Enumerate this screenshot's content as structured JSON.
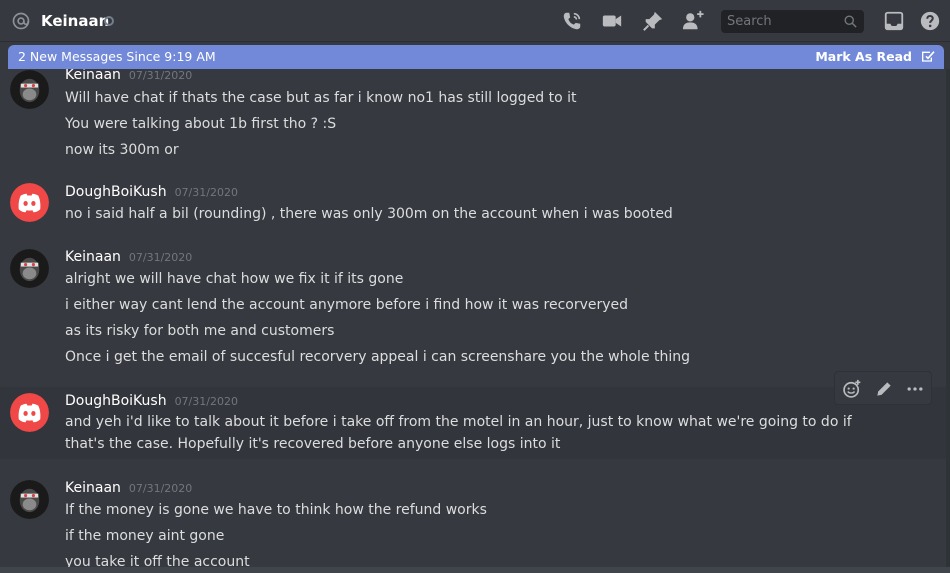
{
  "header": {
    "channel_name": "Keinaan",
    "search_placeholder": "Search"
  },
  "new_messages_bar": {
    "text": "2 New Messages Since 9:19 AM",
    "mark_label": "Mark As Read"
  },
  "messages": [
    {
      "author": "Keinaan",
      "timestamp": "07/31/2020",
      "lines": [
        "Will have chat if thats the case but as far i know no1 has still logged to it",
        "You were talking about 1b first tho ? :S",
        "now its 300m or"
      ]
    },
    {
      "author": "DoughBoiKush",
      "timestamp": "07/31/2020",
      "lines": [
        "no i said half a bil (rounding) , there was only 300m on the account when i was booted"
      ]
    },
    {
      "author": "Keinaan",
      "timestamp": "07/31/2020",
      "lines": [
        "alright we will have chat how we fix it if its gone",
        "i either way cant lend the account anymore before i find how it was recorveryed",
        "as its risky for both me and customers",
        "Once i get the email of succesful recorvery appeal i can screenshare you the whole thing"
      ]
    },
    {
      "author": "DoughBoiKush",
      "timestamp": "07/31/2020",
      "lines": [
        "and yeh i'd like to talk about it before i take off from the motel in an hour, just to know what we're going to do if that's the case. Hopefully it's recovered before anyone else logs into it"
      ]
    },
    {
      "author": "Keinaan",
      "timestamp": "07/31/2020",
      "lines": [
        "If the money is gone we have to think how the refund works",
        "if the money aint gone",
        "you take it off the account"
      ]
    }
  ],
  "colors": {
    "background": "#36393f",
    "accent": "#7289da",
    "discord_red": "#f04747",
    "text": "#dcddde",
    "timestamp": "#72767d"
  },
  "icons": {
    "header": [
      "at-icon",
      "call-icon",
      "video-icon",
      "pin-icon",
      "add-member-icon",
      "search-icon",
      "inbox-icon",
      "help-icon"
    ],
    "toolbar": [
      "add-reaction-icon",
      "edit-icon",
      "more-icon"
    ]
  }
}
